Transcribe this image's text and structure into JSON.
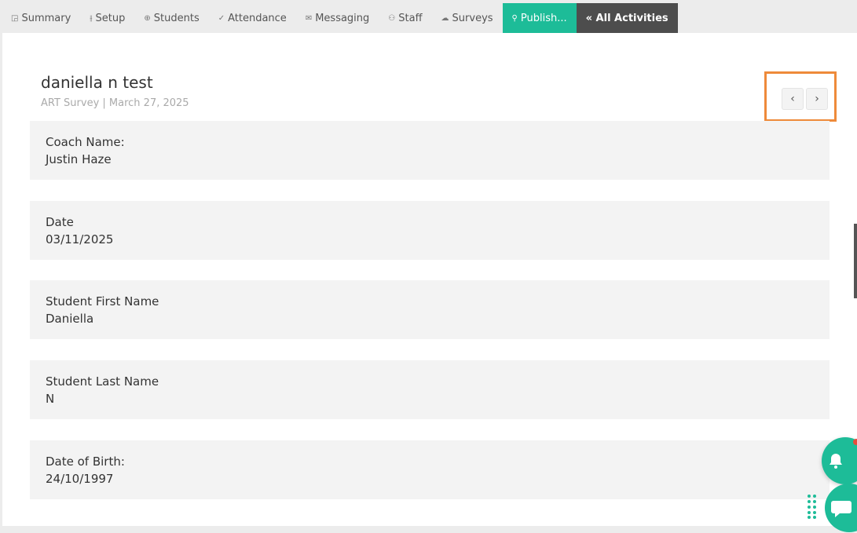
{
  "tabs": [
    {
      "icon": "summary-icon",
      "glyph": "◲",
      "label": "Summary"
    },
    {
      "icon": "setup-icon",
      "glyph": "⫲",
      "label": "Setup"
    },
    {
      "icon": "students-icon",
      "glyph": "⊕",
      "label": "Students"
    },
    {
      "icon": "attendance-icon",
      "glyph": "✓",
      "label": "Attendance"
    },
    {
      "icon": "messaging-icon",
      "glyph": "✉",
      "label": "Messaging"
    },
    {
      "icon": "staff-icon",
      "glyph": "⚇",
      "label": "Staff"
    },
    {
      "icon": "surveys-icon",
      "glyph": "☁",
      "label": "Surveys"
    },
    {
      "icon": "link-icon",
      "glyph": "⚲",
      "label": "Publish..."
    },
    {
      "icon": "",
      "glyph": "",
      "label": "« All Activities"
    }
  ],
  "header": {
    "title": "daniella n test",
    "subtitle": "ART Survey | March 27, 2025"
  },
  "nav": {
    "prev": "‹",
    "next": "›"
  },
  "fields": [
    {
      "label": "Coach Name:",
      "value": "Justin Haze"
    },
    {
      "label": "Date",
      "value": "03/11/2025"
    },
    {
      "label": "Student First Name",
      "value": "Daniella"
    },
    {
      "label": "Student Last Name",
      "value": "N"
    },
    {
      "label": "Date of Birth:",
      "value": "24/10/1997"
    }
  ],
  "colors": {
    "accent": "#1dbc98",
    "highlight": "#ee8a3a",
    "dark_tab": "#4d4d4d"
  }
}
